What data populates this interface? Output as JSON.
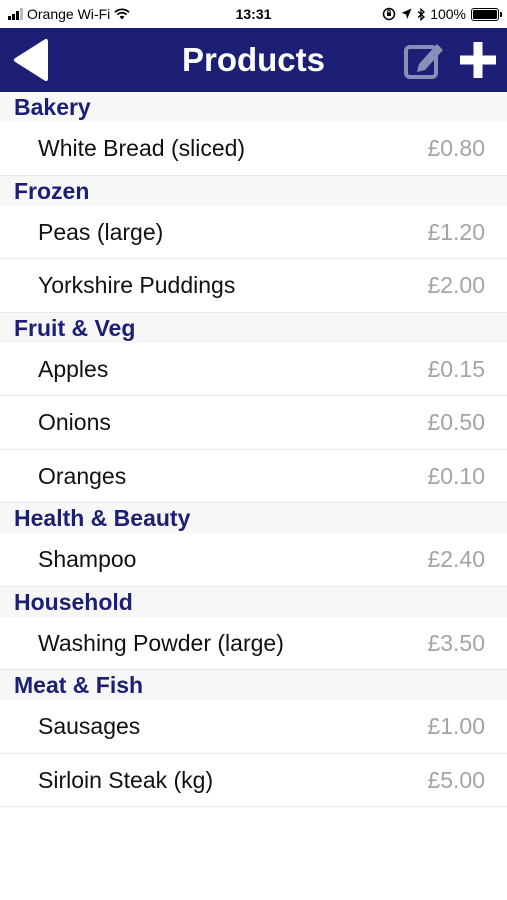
{
  "status_bar": {
    "carrier": "Orange Wi-Fi",
    "time": "13:31",
    "battery": "100%"
  },
  "nav": {
    "title": "Products",
    "icons": {
      "back": "back-arrow-icon",
      "edit": "edit-icon",
      "add": "plus-icon"
    }
  },
  "colors": {
    "nav_background": "#1c1f73",
    "section_text": "#1c1f73",
    "price_text": "#a4a4a4"
  },
  "sections": [
    {
      "title": "Bakery",
      "items": [
        {
          "name": "White Bread (sliced)",
          "price": "£0.80"
        }
      ]
    },
    {
      "title": "Frozen",
      "items": [
        {
          "name": "Peas (large)",
          "price": "£1.20"
        },
        {
          "name": "Yorkshire Puddings",
          "price": "£2.00"
        }
      ]
    },
    {
      "title": "Fruit & Veg",
      "items": [
        {
          "name": "Apples",
          "price": "£0.15"
        },
        {
          "name": "Onions",
          "price": "£0.50"
        },
        {
          "name": "Oranges",
          "price": "£0.10"
        }
      ]
    },
    {
      "title": "Health & Beauty",
      "items": [
        {
          "name": "Shampoo",
          "price": "£2.40"
        }
      ]
    },
    {
      "title": "Household",
      "items": [
        {
          "name": "Washing Powder (large)",
          "price": "£3.50"
        }
      ]
    },
    {
      "title": "Meat & Fish",
      "items": [
        {
          "name": "Sausages",
          "price": "£1.00"
        },
        {
          "name": "Sirloin Steak (kg)",
          "price": "£5.00"
        }
      ]
    }
  ]
}
